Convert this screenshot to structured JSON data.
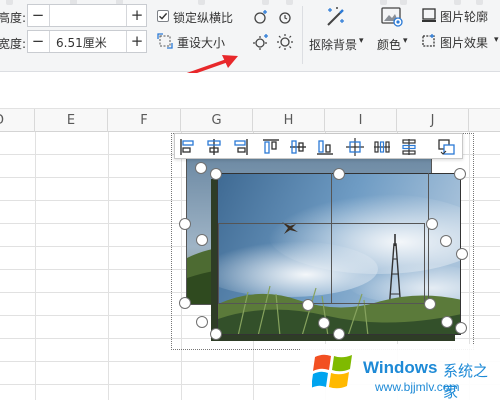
{
  "ribbon": {
    "height_label": "高度:",
    "width_label": "宽度:",
    "height_value": "",
    "width_value": "6.51厘米",
    "minus": "−",
    "plus": "+",
    "lock_ratio_label": "锁定纵横比",
    "lock_ratio_checked": true,
    "reset_size_label": "重设大小",
    "remove_bg_label": "抠除背景",
    "color_label": "颜色",
    "outline_label": "图片轮廓",
    "effects_label": "图片效果",
    "dropdown": "▾"
  },
  "sheet": {
    "columns": [
      "D",
      "E",
      "F",
      "G",
      "H",
      "I",
      "J"
    ]
  },
  "picture": {
    "description_icons": [
      "align-left-icon",
      "align-center-icon",
      "align-right-icon",
      "align-top-icon",
      "align-middle-icon",
      "align-bottom-icon",
      "distribute-horizontal-icon",
      "distribute-vertical-icon",
      "layout-options-icon"
    ]
  },
  "watermark": {
    "brand": "Windows",
    "site_cn": "系统之家",
    "url": "www.bjjmlv.com"
  },
  "colors": {
    "accent_red": "#e8282b",
    "win_blue": "#1e8ad6"
  }
}
